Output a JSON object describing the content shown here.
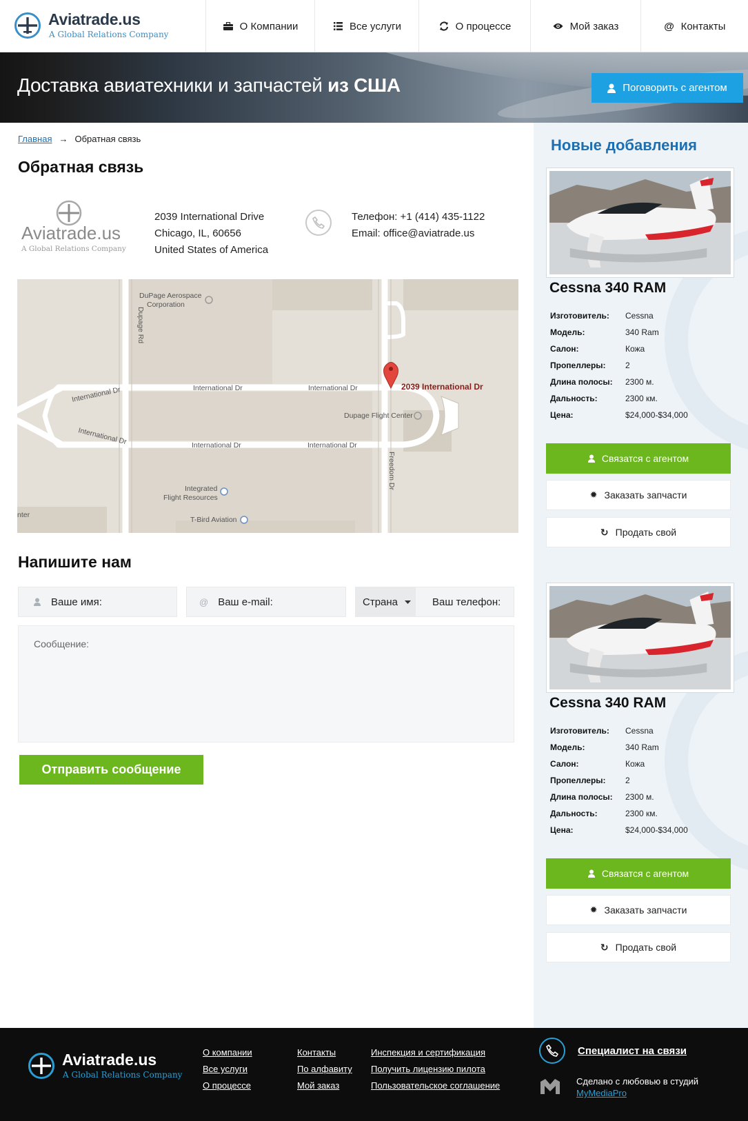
{
  "header": {
    "logo_name": "Aviatrade.us",
    "logo_tagline": "A Global Relations Company",
    "nav": [
      {
        "label": "О Компании",
        "icon": "briefcase-icon"
      },
      {
        "label": "Все услуги",
        "icon": "list-icon"
      },
      {
        "label": "О процессе",
        "icon": "refresh-icon"
      },
      {
        "label": "Мой заказ",
        "icon": "eye-icon"
      },
      {
        "label": "Контакты",
        "icon": "at-icon"
      }
    ]
  },
  "hero": {
    "title_main": "Доставка авиатехники и запчастей ",
    "title_bold": "из США",
    "agent_button": "Поговорить с агентом"
  },
  "breadcrumb": {
    "home": "Главная",
    "arrow": "→",
    "current": "Обратная связь"
  },
  "contact": {
    "page_title": "Обратная связь",
    "address": [
      "2039 International Drive",
      "Chicago, IL, 60656",
      "United States of America"
    ],
    "phone": "Телефон: +1 (414) 435-1122",
    "email": "Email: office@aviatrade.us"
  },
  "map": {
    "labels": [
      "DuPage Aerospace",
      "Corporation",
      "Dupage Rd",
      "International Dr",
      "2039 International Dr",
      "Dupage Flight Center",
      "Freedom Dr",
      "Integrated",
      "Flight Resources",
      "T-Bird Aviation",
      "nter"
    ]
  },
  "form": {
    "title": "Напишите нам",
    "name_placeholder": "Ваше имя:",
    "email_placeholder": "Ваш e-mail:",
    "country": "Страна",
    "phone_placeholder": "Ваш телефон:",
    "message_placeholder": "Сообщение:",
    "submit": "Отправить сообщение"
  },
  "sidebar": {
    "title": "Новые добавления",
    "spec_labels": [
      "Изготовитель:",
      "Модель:",
      "Салон:",
      "Пропеллеры:",
      "Длина полосы:",
      "Дальность:",
      "Цена:"
    ],
    "cards": [
      {
        "title": "Cessna 340 RAM",
        "specs": [
          "Cessna",
          "340 Ram",
          "Кожа",
          "2",
          "2300 м.",
          "2300 км.",
          "$24,000-$34,000"
        ],
        "buttons": [
          "Связатся с агентом",
          "Заказать запчасти",
          "Продать свой"
        ]
      },
      {
        "title": "Cessna 340 RAM",
        "specs": [
          "Cessna",
          "340 Ram",
          "Кожа",
          "2",
          "2300 м.",
          "2300 км.",
          "$24,000-$34,000"
        ],
        "buttons": [
          "Связатся с агентом",
          "Заказать запчасти",
          "Продать свой"
        ]
      }
    ]
  },
  "footer": {
    "logo_name": "Aviatrade.us",
    "logo_tagline": "A Global Relations Company",
    "col1": [
      "О компании",
      "Все услуги",
      "О процессе"
    ],
    "col2": [
      "Контакты",
      "По алфавиту",
      "Мой заказ"
    ],
    "col3": [
      "Инспекция и сертификация",
      "Получить лицензию пилота",
      "Пользовательское соглашение"
    ],
    "specialist": "Специалист на связи",
    "made_text": "Сделано с любовью в студий",
    "made_link": "MyMediaPro"
  },
  "colors": {
    "accent_blue": "#1ea1e2",
    "link_blue": "#1f6fb0",
    "green": "#6cb71d",
    "footer_bg": "#0d0d0d",
    "sidebar_bg": "#eef3f7"
  }
}
